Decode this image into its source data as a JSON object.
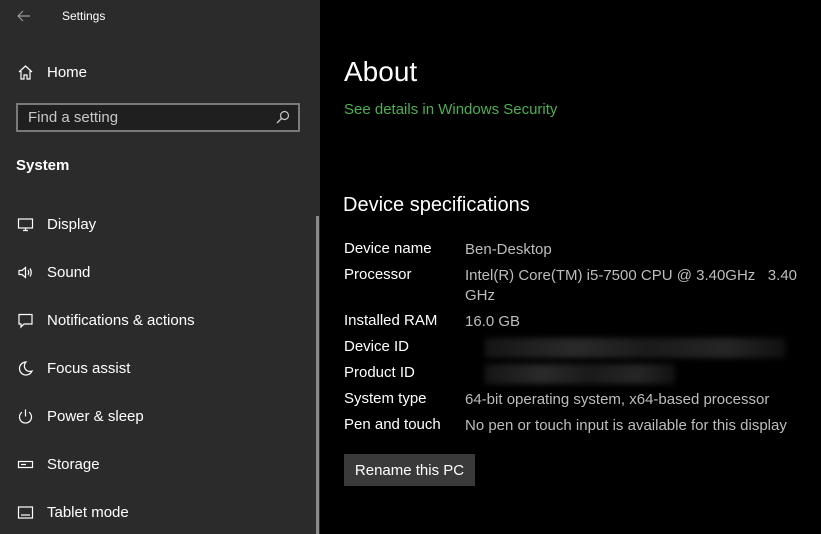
{
  "window": {
    "title": "Settings"
  },
  "sidebar": {
    "home_label": "Home",
    "search": {
      "placeholder": "Find a setting",
      "value": ""
    },
    "section_label": "System",
    "items": [
      {
        "label": "Display",
        "icon": "monitor-icon"
      },
      {
        "label": "Sound",
        "icon": "speaker-icon"
      },
      {
        "label": "Notifications & actions",
        "icon": "notification-icon"
      },
      {
        "label": "Focus assist",
        "icon": "moon-icon"
      },
      {
        "label": "Power & sleep",
        "icon": "power-icon"
      },
      {
        "label": "Storage",
        "icon": "storage-icon"
      },
      {
        "label": "Tablet mode",
        "icon": "tablet-mode-icon"
      }
    ]
  },
  "main": {
    "title": "About",
    "security_link": "See details in Windows Security",
    "specs_heading": "Device specifications",
    "specs": {
      "device_name": {
        "label": "Device name",
        "value": "Ben-Desktop"
      },
      "processor": {
        "label": "Processor",
        "value": "Intel(R) Core(TM) i5-7500 CPU @ 3.40GHz   3.40 GHz"
      },
      "installed_ram": {
        "label": "Installed RAM",
        "value": "16.0 GB"
      },
      "device_id": {
        "label": "Device ID"
      },
      "product_id": {
        "label": "Product ID"
      },
      "system_type": {
        "label": "System type",
        "value": "64-bit operating system, x64-based processor"
      },
      "pen_and_touch": {
        "label": "Pen and touch",
        "value": "No pen or touch input is available for this display"
      }
    },
    "rename_button": "Rename this PC"
  },
  "colors": {
    "sidebar_bg": "#2b2b2b",
    "main_bg": "#000000",
    "link_green": "#4caf50"
  }
}
